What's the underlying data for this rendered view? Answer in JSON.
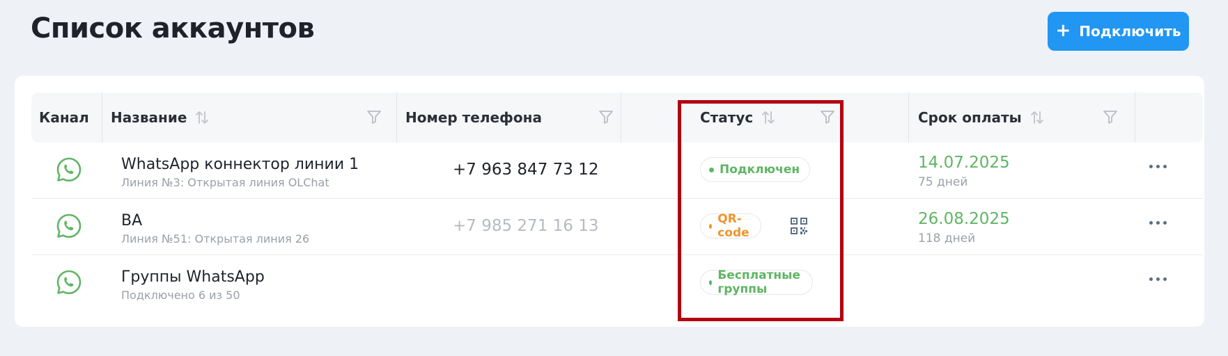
{
  "page": {
    "title": "Список аккаунтов"
  },
  "toolbar": {
    "connect_label": "Подключить",
    "connect_icon": "plus-icon"
  },
  "table": {
    "columns": [
      {
        "label": "Канал",
        "sortable": false,
        "filter": false
      },
      {
        "label": "Название",
        "sortable": true,
        "filter": true
      },
      {
        "label": "Номер телефона",
        "sortable": false,
        "filter": true
      },
      {
        "label": "Статус",
        "sortable": true,
        "filter": true
      },
      {
        "label": "Срок оплаты",
        "sortable": true,
        "filter": true
      },
      {
        "label": "",
        "sortable": false,
        "filter": false
      }
    ],
    "rows": [
      {
        "channel_icon": "whatsapp-icon",
        "name": "WhatsApp коннектор линии 1",
        "subtitle": "Линия №3: Открытая линия OLChat",
        "phone": "+7 963 847 73 12",
        "status": "Подключен",
        "due_date": "14.07.2025",
        "days_left": "75 дней"
      },
      {
        "channel_icon": "whatsapp-icon",
        "name": "BA",
        "subtitle": "Линия №51: Открытая линия 26",
        "phone": "+7 985 271 16 13",
        "status": "QR-code",
        "due_date": "26.08.2025",
        "days_left": "118 дней"
      },
      {
        "channel_icon": "whatsapp-icon",
        "name": "Группы WhatsApp",
        "subtitle": "Подключено 6 из 50",
        "phone": "",
        "status": "Бесплатные группы",
        "due_date": "",
        "days_left": ""
      }
    ]
  },
  "colors": {
    "accent": "#2196f3",
    "status_green": "#5fb563",
    "status_orange": "#f0942d",
    "highlight": "#b30012"
  }
}
